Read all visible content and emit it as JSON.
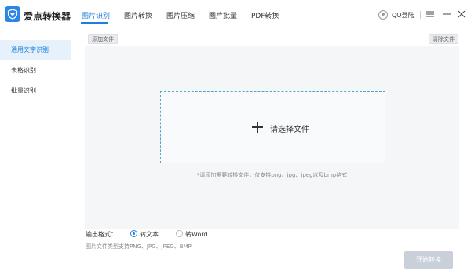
{
  "app": {
    "title": "爱点转换器"
  },
  "nav": {
    "tabs": [
      {
        "label": "图片识别"
      },
      {
        "label": "图片转换"
      },
      {
        "label": "图片压缩"
      },
      {
        "label": "图片批量"
      },
      {
        "label": "PDF转换"
      }
    ],
    "active_tab": 0
  },
  "user": {
    "login_label": "QQ登陆"
  },
  "window_controls": [
    "menu-icon",
    "minimize-icon",
    "close-icon"
  ],
  "sidebar": {
    "items": [
      {
        "label": "通用文字识别"
      },
      {
        "label": "表格识别"
      },
      {
        "label": "批量识别"
      }
    ],
    "active_item": 0
  },
  "toolbar": {
    "add_file_label": "添加文件",
    "clear_file_label": "清除文件"
  },
  "dropzone": {
    "label": "请选择文件",
    "hint": "*请添加需要转换文件，仅支持png、jpg、jpeg以及bmp格式"
  },
  "output": {
    "format_label": "输出格式：",
    "options": [
      {
        "label": "转文本",
        "selected": true
      },
      {
        "label": "转Word",
        "selected": false
      }
    ],
    "support_note": "图片文件类型支持PNG、JPG、JPEG、BMP"
  },
  "actions": {
    "start_label": "开始转换"
  },
  "colors": {
    "accent": "#1b7fdf",
    "logo_bg": "#2d86e6",
    "dropzone_border": "#4fa7c7",
    "workspace_bg": "#f5f6f8",
    "start_button_disabled": "#c9d0da"
  }
}
